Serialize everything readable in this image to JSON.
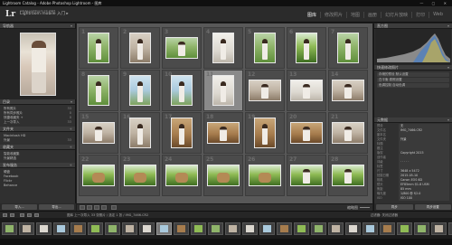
{
  "window": {
    "title": "Lightroom Catalog - Adobe Photoshop Lightroom - 图库",
    "controls": "— ▢ ✕"
  },
  "identity": {
    "logo": "Lr",
    "line1": "Adobe Lightroom CC 2015",
    "line2": "Lightroom mobile 入门 ▸"
  },
  "modules": [
    "图库",
    "修改照片",
    "地图",
    "画册",
    "幻灯片放映",
    "打印",
    "Web"
  ],
  "active_module": "图库",
  "left_panel": {
    "navigator_title": "导航器",
    "navigator_zoom": "适合  填满  1:1  3:1",
    "catalog_title": "目录",
    "catalog_items": [
      {
        "label": "所有照片",
        "count": "33"
      },
      {
        "label": "所有同步照片",
        "count": "0"
      },
      {
        "label": "快捷收藏夹 +",
        "count": "0"
      },
      {
        "label": "上一次导入",
        "count": "33"
      }
    ],
    "folders_title": "文件夹",
    "folders": [
      {
        "label": "Macintosh HD",
        "count": ""
      },
      {
        "label": "外景",
        "count": "33"
      }
    ],
    "collections_title": "收藏夹",
    "collections": [
      {
        "label": "智能收藏集",
        "count": ""
      },
      {
        "label": "外景精选",
        "count": ""
      }
    ],
    "publish_title": "发布服务",
    "publish_items": [
      {
        "label": "硬盘",
        "count": ""
      },
      {
        "label": "Facebook",
        "count": ""
      },
      {
        "label": "Flickr",
        "count": ""
      },
      {
        "label": "Behance",
        "count": ""
      }
    ],
    "import_button": "导入...",
    "export_button": "导出..."
  },
  "grid": {
    "cells": [
      {
        "n": "1",
        "o": "p",
        "c": "green",
        "s": "fig"
      },
      {
        "n": "2",
        "o": "p",
        "c": "room",
        "s": "fig"
      },
      {
        "n": "3",
        "o": "l",
        "c": "green",
        "s": "fig"
      },
      {
        "n": "4",
        "o": "p",
        "c": "white",
        "s": "fig"
      },
      {
        "n": "5",
        "o": "p",
        "c": "green",
        "s": "fig"
      },
      {
        "n": "6",
        "o": "p",
        "c": "field",
        "s": "fig"
      },
      {
        "n": "7",
        "o": "p",
        "c": "green",
        "s": "fig"
      },
      {
        "n": "8",
        "o": "p",
        "c": "green",
        "s": "fig"
      },
      {
        "n": "9",
        "o": "p",
        "c": "sky",
        "s": "fig"
      },
      {
        "n": "10",
        "o": "p",
        "c": "sky",
        "s": "fig"
      },
      {
        "n": "11",
        "o": "p",
        "c": "white",
        "s": "fig",
        "sel": true
      },
      {
        "n": "12",
        "o": "l",
        "c": "room",
        "s": "fig"
      },
      {
        "n": "13",
        "o": "l",
        "c": "white",
        "s": "fig"
      },
      {
        "n": "14",
        "o": "l",
        "c": "room",
        "s": "fig"
      },
      {
        "n": "15",
        "o": "l",
        "c": "room",
        "s": "fig"
      },
      {
        "n": "16",
        "o": "p",
        "c": "room",
        "s": "fig"
      },
      {
        "n": "17",
        "o": "p",
        "c": "warm",
        "s": "fig"
      },
      {
        "n": "18",
        "o": "l",
        "c": "warm",
        "s": "fig"
      },
      {
        "n": "19",
        "o": "p",
        "c": "warm",
        "s": "fig"
      },
      {
        "n": "20",
        "o": "l",
        "c": "warm",
        "s": "fig"
      },
      {
        "n": "21",
        "o": "l",
        "c": "room",
        "s": "fig"
      },
      {
        "n": "22",
        "o": "l",
        "c": "field",
        "s": "dog"
      },
      {
        "n": "23",
        "o": "l",
        "c": "field",
        "s": "dog"
      },
      {
        "n": "24",
        "o": "l",
        "c": "field",
        "s": "dog"
      },
      {
        "n": "25",
        "o": "l",
        "c": "field",
        "s": "dog"
      },
      {
        "n": "26",
        "o": "l",
        "c": "field",
        "s": "dog"
      },
      {
        "n": "27",
        "o": "l",
        "c": "field",
        "s": "fig"
      },
      {
        "n": "28",
        "o": "l",
        "c": "field",
        "s": "fig"
      }
    ]
  },
  "toolbar": {
    "sort_label": "缩略图"
  },
  "right_panel": {
    "histogram_title": "直方图",
    "quick_develop_title": "快速修改照片",
    "quick_rows": [
      "存储的预设  默认设置",
      "白平衡  原照设置",
      "色调控制  自动色调"
    ],
    "metadata_title": "元数据",
    "metadata": [
      {
        "k": "预设",
        "v": "无"
      },
      {
        "k": "文件名",
        "v": "IMG_7466.CR2"
      },
      {
        "k": "副本名",
        "v": ""
      },
      {
        "k": "文件夹",
        "v": "外景"
      },
      {
        "k": "标题",
        "v": ""
      },
      {
        "k": "题注",
        "v": ""
      },
      {
        "k": "版权",
        "v": "Copyright 2015"
      },
      {
        "k": "创作者",
        "v": ""
      },
      {
        "k": "评级",
        "v": "·  ·  ·  ·  ·"
      },
      {
        "k": "标签",
        "v": ""
      },
      {
        "k": "尺寸",
        "v": "3648 x 5472"
      },
      {
        "k": "拍摄日期",
        "v": "2015-05-10"
      },
      {
        "k": "相机",
        "v": "Canon EOS 6D"
      },
      {
        "k": "镜头",
        "v": "EF85mm f/1.8 USM"
      },
      {
        "k": "焦距",
        "v": "85 mm"
      },
      {
        "k": "曝光度",
        "v": "1/800 秒 f/2.0"
      },
      {
        "k": "ISO",
        "v": "ISO 100"
      }
    ],
    "sync_button": "同步",
    "sync_settings_button": "同步设置"
  },
  "filmbar": {
    "path": "图库  上一次导入  33 张照片 / 选定 1 张 / IMG_7466.CR2",
    "filter": "过滤器:  关闭过滤器"
  },
  "filmstrip": {
    "count": 28,
    "selected_index": 9
  }
}
